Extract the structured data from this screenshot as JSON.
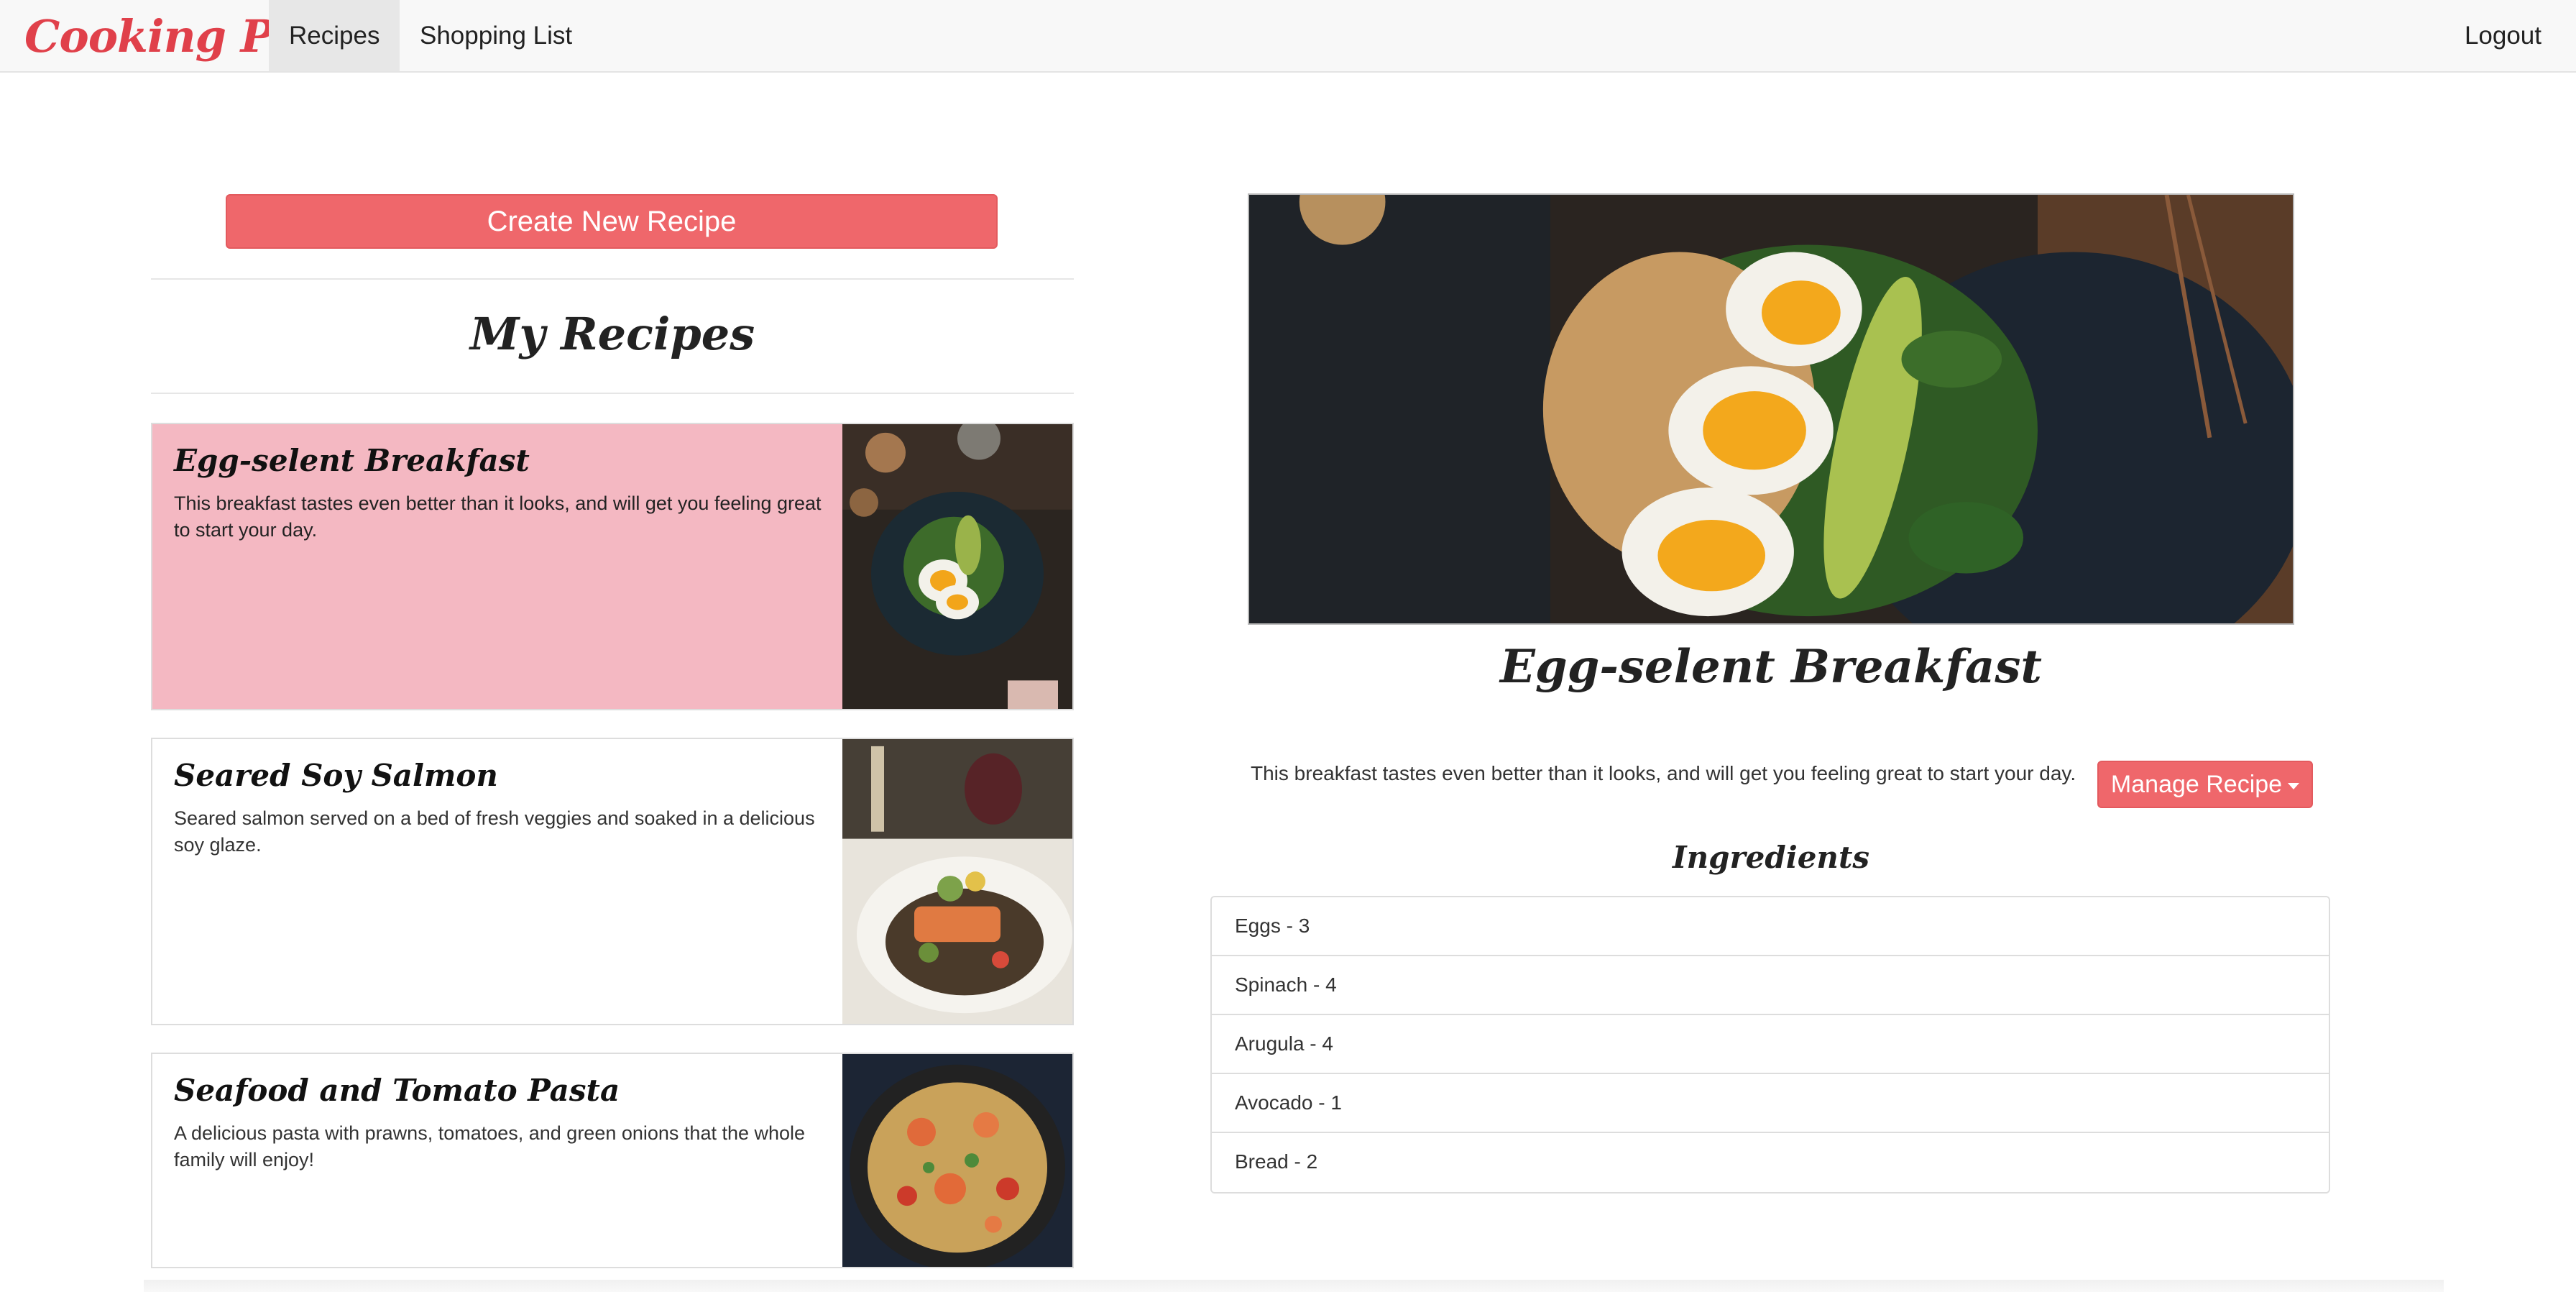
{
  "nav": {
    "brand": "Cooking Papa",
    "items": [
      {
        "label": "Recipes"
      },
      {
        "label": "Shopping List"
      }
    ],
    "logout": "Logout"
  },
  "left": {
    "create_button": "Create New Recipe",
    "heading": "My Recipes",
    "recipes": [
      {
        "title": "Egg-selent Breakfast",
        "description": "This breakfast tastes even better than it looks, and will get you feeling great to start your day.",
        "image": "egg-breakfast-photo",
        "selected": true
      },
      {
        "title": "Seared Soy Salmon",
        "description": "Seared salmon served on a bed of fresh veggies and soaked in a delicious soy glaze.",
        "image": "salmon-plate-photo",
        "selected": false
      },
      {
        "title": "Seafood and Tomato Pasta",
        "description": "A delicious pasta with prawns, tomatoes, and green onions that the whole family will enjoy!",
        "image": "seafood-pasta-photo",
        "selected": false
      }
    ]
  },
  "detail": {
    "image": "egg-breakfast-hero-photo",
    "title": "Egg-selent Breakfast",
    "description": "This breakfast tastes even better than it looks, and will get you feeling great to start your day.",
    "manage_button": "Manage Recipe",
    "ingredients_heading": "Ingredients",
    "ingredients": [
      "Eggs - 3",
      "Spinach - 4",
      "Arugula - 4",
      "Avocado - 1",
      "Bread - 2"
    ]
  },
  "colors": {
    "brand": "#e0404a",
    "accent": "#ef676b",
    "selected_card": "#f4b8c2",
    "navbar_bg": "#f8f8f8",
    "nav_active_bg": "#e7e7e7"
  }
}
